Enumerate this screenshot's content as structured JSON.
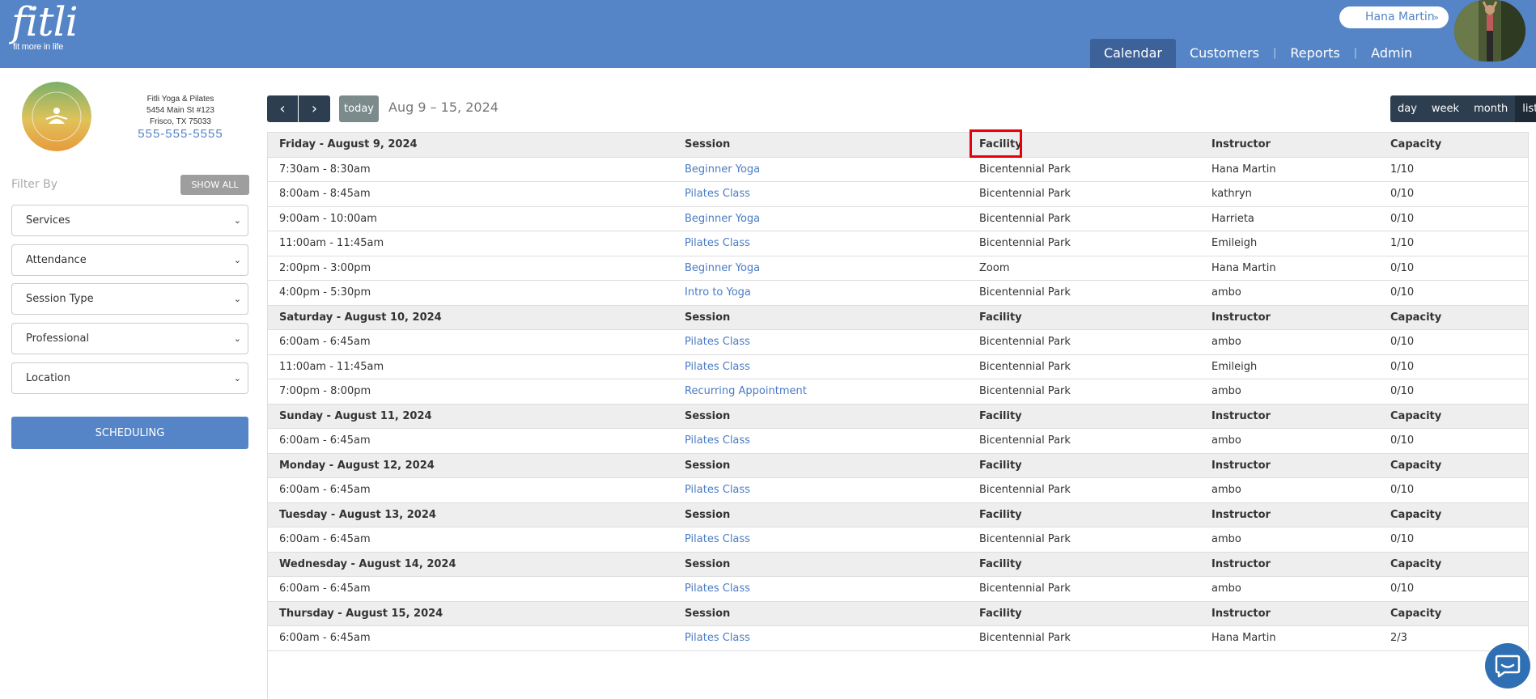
{
  "app": {
    "brand": "fitli",
    "tagline": "fit more in life"
  },
  "user": {
    "name": "Hana Martin"
  },
  "nav": {
    "items": [
      {
        "label": "Calendar",
        "active": true
      },
      {
        "label": "Customers",
        "active": false
      },
      {
        "label": "Reports",
        "active": false
      },
      {
        "label": "Admin",
        "active": false
      }
    ]
  },
  "business": {
    "name": "Fitli Yoga & Pilates",
    "address1": "5454 Main St #123",
    "address2": "Frisco, TX 75033",
    "phone": "555-555-5555"
  },
  "filters": {
    "label": "Filter By",
    "show_all": "SHOW ALL",
    "selects": [
      "Services",
      "Attendance",
      "Session Type",
      "Professional",
      "Location"
    ],
    "scheduling": "SCHEDULING"
  },
  "toolbar": {
    "prev": "‹",
    "next": "›",
    "today": "today",
    "date_range": "Aug 9 – 15, 2024",
    "views": [
      {
        "label": "day",
        "active": false
      },
      {
        "label": "week",
        "active": false
      },
      {
        "label": "month",
        "active": false
      },
      {
        "label": "list",
        "active": true
      }
    ]
  },
  "columns": {
    "session": "Session",
    "facility": "Facility",
    "instructor": "Instructor",
    "capacity": "Capacity"
  },
  "days": [
    {
      "label": "Friday - August 9, 2024",
      "sessions": [
        {
          "time": "7:30am - 8:30am",
          "session": "Beginner Yoga",
          "facility": "Bicentennial Park",
          "instructor": "Hana Martin",
          "capacity": "1/10"
        },
        {
          "time": "8:00am - 8:45am",
          "session": "Pilates Class",
          "facility": "Bicentennial Park",
          "instructor": "kathryn",
          "capacity": "0/10"
        },
        {
          "time": "9:00am - 10:00am",
          "session": "Beginner Yoga",
          "facility": "Bicentennial Park",
          "instructor": "Harrieta",
          "capacity": "0/10"
        },
        {
          "time": "11:00am - 11:45am",
          "session": "Pilates Class",
          "facility": "Bicentennial Park",
          "instructor": "Emileigh",
          "capacity": "1/10"
        },
        {
          "time": "2:00pm - 3:00pm",
          "session": "Beginner Yoga",
          "facility": "Zoom",
          "instructor": "Hana Martin",
          "capacity": "0/10"
        },
        {
          "time": "4:00pm - 5:30pm",
          "session": "Intro to Yoga",
          "facility": "Bicentennial Park",
          "instructor": "ambo",
          "capacity": "0/10"
        }
      ]
    },
    {
      "label": "Saturday - August 10, 2024",
      "sessions": [
        {
          "time": "6:00am - 6:45am",
          "session": "Pilates Class",
          "facility": "Bicentennial Park",
          "instructor": "ambo",
          "capacity": "0/10"
        },
        {
          "time": "11:00am - 11:45am",
          "session": "Pilates Class",
          "facility": "Bicentennial Park",
          "instructor": "Emileigh",
          "capacity": "0/10"
        },
        {
          "time": "7:00pm - 8:00pm",
          "session": "Recurring Appointment",
          "facility": "Bicentennial Park",
          "instructor": "ambo",
          "capacity": "0/10"
        }
      ]
    },
    {
      "label": "Sunday - August 11, 2024",
      "sessions": [
        {
          "time": "6:00am - 6:45am",
          "session": "Pilates Class",
          "facility": "Bicentennial Park",
          "instructor": "ambo",
          "capacity": "0/10"
        }
      ]
    },
    {
      "label": "Monday - August 12, 2024",
      "sessions": [
        {
          "time": "6:00am - 6:45am",
          "session": "Pilates Class",
          "facility": "Bicentennial Park",
          "instructor": "ambo",
          "capacity": "0/10"
        }
      ]
    },
    {
      "label": "Tuesday - August 13, 2024",
      "sessions": [
        {
          "time": "6:00am - 6:45am",
          "session": "Pilates Class",
          "facility": "Bicentennial Park",
          "instructor": "ambo",
          "capacity": "0/10"
        }
      ]
    },
    {
      "label": "Wednesday - August 14, 2024",
      "sessions": [
        {
          "time": "6:00am - 6:45am",
          "session": "Pilates Class",
          "facility": "Bicentennial Park",
          "instructor": "ambo",
          "capacity": "0/10"
        }
      ]
    },
    {
      "label": "Thursday - August 15, 2024",
      "sessions": [
        {
          "time": "6:00am - 6:45am",
          "session": "Pilates Class",
          "facility": "Bicentennial Park",
          "instructor": "Hana Martin",
          "capacity": "2/3"
        }
      ]
    }
  ],
  "icons": {
    "chat": "chat-bubble-icon",
    "user_dropdown": "chevron-down-icon"
  },
  "colors": {
    "header": "#5585c6",
    "accent_dark": "#2c3e50",
    "link": "#4a7bc4",
    "highlight": "#e8000b"
  }
}
